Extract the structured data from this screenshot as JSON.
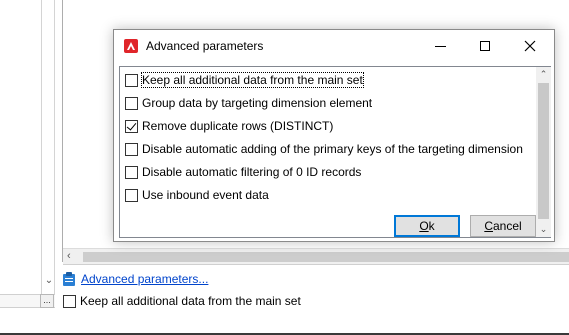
{
  "dialog": {
    "title": "Advanced parameters",
    "options": [
      {
        "label": "Keep all additional data from the main set",
        "checked": false
      },
      {
        "label": "Group data by targeting dimension element",
        "checked": false
      },
      {
        "label": "Remove duplicate rows (DISTINCT)",
        "checked": true
      },
      {
        "label": "Disable automatic adding of the primary keys of the targeting dimension",
        "checked": false
      },
      {
        "label": "Disable automatic filtering of 0 ID records",
        "checked": false
      },
      {
        "label": "Use inbound event data",
        "checked": false
      }
    ],
    "ok_mnemonic": "O",
    "ok_rest": "k",
    "cancel_mnemonic": "C",
    "cancel_rest": "ancel"
  },
  "background": {
    "advanced_link": "Advanced parameters...",
    "keep_all_label": "Keep all additional data from the main set",
    "keep_all_checked": false,
    "ellipsis": "..."
  }
}
